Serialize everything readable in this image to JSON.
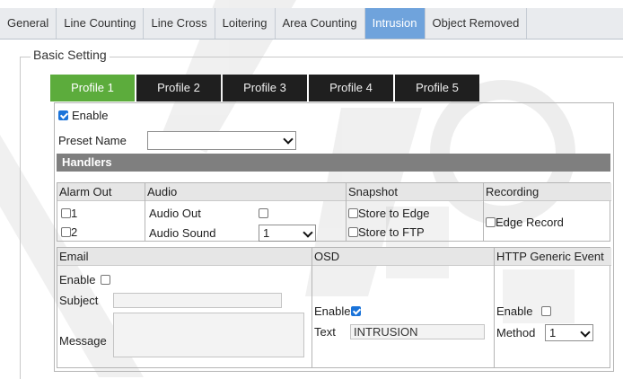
{
  "top_tabs": [
    "General",
    "Line Counting",
    "Line Cross",
    "Loitering",
    "Area Counting",
    "Intrusion",
    "Object Removed"
  ],
  "active_top_tab": "Intrusion",
  "fieldset_legend": "Basic Setting",
  "profile_tabs": [
    "Profile 1",
    "Profile 2",
    "Profile 3",
    "Profile 4",
    "Profile 5"
  ],
  "active_profile": "Profile 1",
  "enable": {
    "label": "Enable",
    "checked": true
  },
  "preset": {
    "label": "Preset Name",
    "value": ""
  },
  "handlers": {
    "title": "Handlers",
    "alarm_out": {
      "header": "Alarm Out",
      "items": [
        "1",
        "2"
      ]
    },
    "audio": {
      "header": "Audio",
      "out_label": "Audio Out",
      "sound_label": "Audio Sound",
      "sound_value": "1"
    },
    "snapshot": {
      "header": "Snapshot",
      "edge_label": "Store to Edge",
      "ftp_label": "Store to FTP"
    },
    "recording": {
      "header": "Recording",
      "edge_label": "Edge Record"
    }
  },
  "email": {
    "header": "Email",
    "enable_label": "Enable",
    "subject_label": "Subject",
    "message_label": "Message",
    "subject_value": "",
    "message_value": ""
  },
  "osd": {
    "header": "OSD",
    "enable_label": "Enable",
    "enable_checked": true,
    "text_label": "Text",
    "text_value": "INTRUSION"
  },
  "http": {
    "header": "HTTP Generic Event",
    "enable_label": "Enable",
    "method_label": "Method",
    "method_value": "1"
  },
  "colors": {
    "active_top_tab": "#6fa3dc",
    "active_profile_tab": "#5cac3c",
    "profile_tab": "#1f1f1f",
    "handlers_bar": "#7f7f7f",
    "checkbox_checked": "#1a73d9"
  }
}
